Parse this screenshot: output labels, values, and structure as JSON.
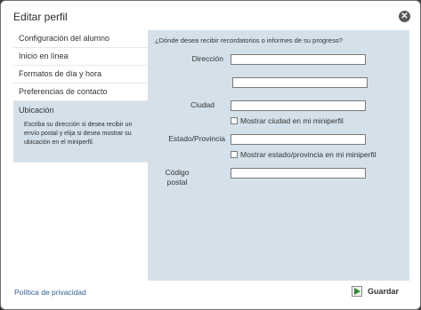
{
  "dialog": {
    "title": "Editar perfil"
  },
  "sidebar": {
    "items": [
      {
        "label": "Configuración del alumno"
      },
      {
        "label": "Inicio en línea"
      },
      {
        "label": "Formatos de día y hora"
      },
      {
        "label": "Preferencias de contacto"
      }
    ],
    "active": {
      "label": "Ubicación",
      "description": "Escriba su dirección si desea recibir un envío postal y elija si desea mostrar su ubicación en el miniperfil."
    }
  },
  "form": {
    "question": "¿Dónde desea recibir recordatorios o informes de su progreso?",
    "address_label": "Dirección",
    "address_line1_value": "",
    "address_line2_value": "",
    "city_label": "Ciudad",
    "city_value": "",
    "show_city_label": "Mostrar ciudad en mi miniperfil",
    "show_city_checked": false,
    "state_label": "Estado/Provincia",
    "state_value": "",
    "show_state_label": "Mostrar estado/provincia en mi miniperfil",
    "show_state_checked": false,
    "postal_label_line1": "Código",
    "postal_label_line2": "postal",
    "postal_value": ""
  },
  "footer": {
    "privacy_link": "Política de privacidad",
    "save_label": "Guardar"
  },
  "icons": {
    "close": "close-icon",
    "save": "play-arrow-icon"
  },
  "colors": {
    "panel": "#d4e1ea",
    "link": "#2e5f8f",
    "save_arrow": "#2e8b2e"
  }
}
